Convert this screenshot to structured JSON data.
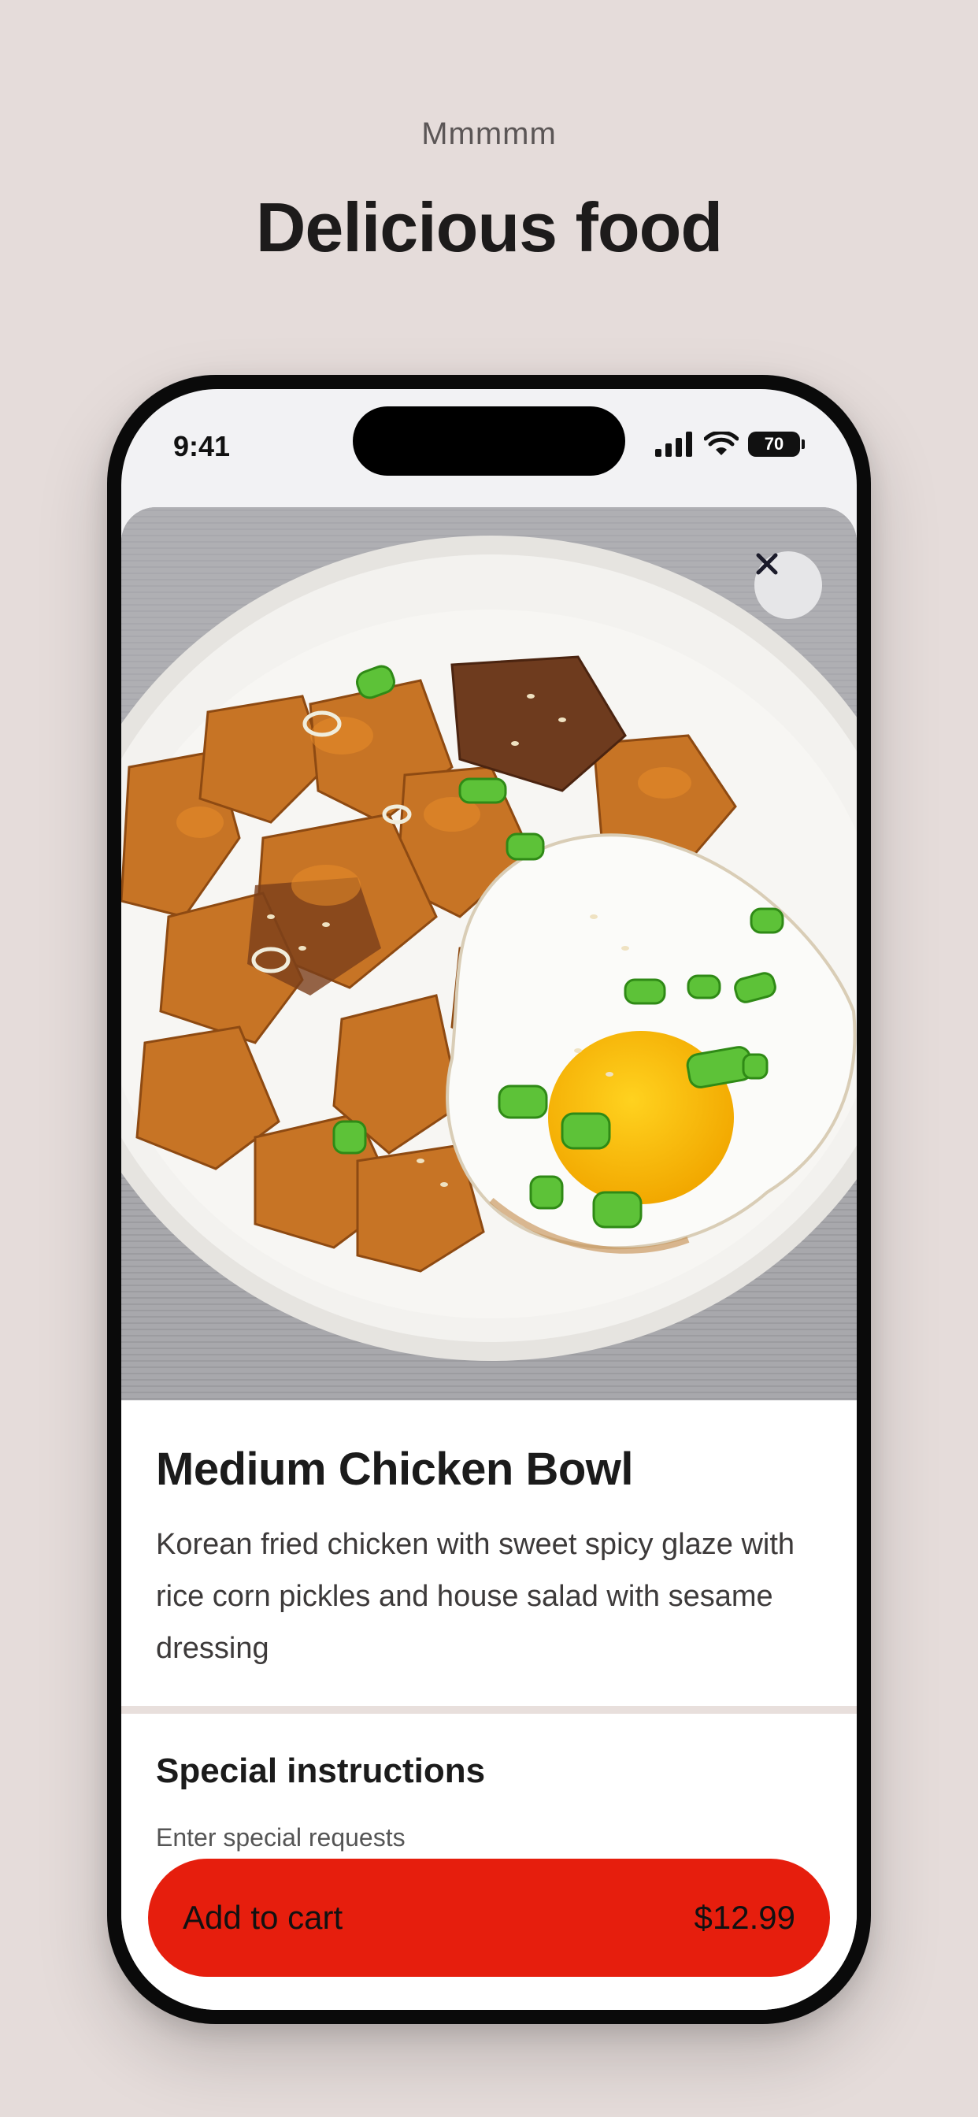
{
  "header": {
    "eyebrow": "Mmmmm",
    "title": "Delicious food"
  },
  "status_bar": {
    "time": "9:41",
    "battery": "70"
  },
  "item": {
    "name": "Medium Chicken Bowl",
    "description": "Korean fried chicken with sweet spicy glaze with rice corn pickles and house salad with sesame dressing"
  },
  "instructions": {
    "title": "Special instructions",
    "placeholder": "Enter special requests"
  },
  "cart": {
    "label": "Add to cart",
    "price": "$12.99"
  },
  "colors": {
    "page_background": "#e5dcda",
    "accent": "#e61e0d",
    "phone_frame": "#0a0a0a"
  },
  "icons": [
    "close-icon",
    "signal-icon",
    "wifi-icon",
    "battery-icon"
  ]
}
